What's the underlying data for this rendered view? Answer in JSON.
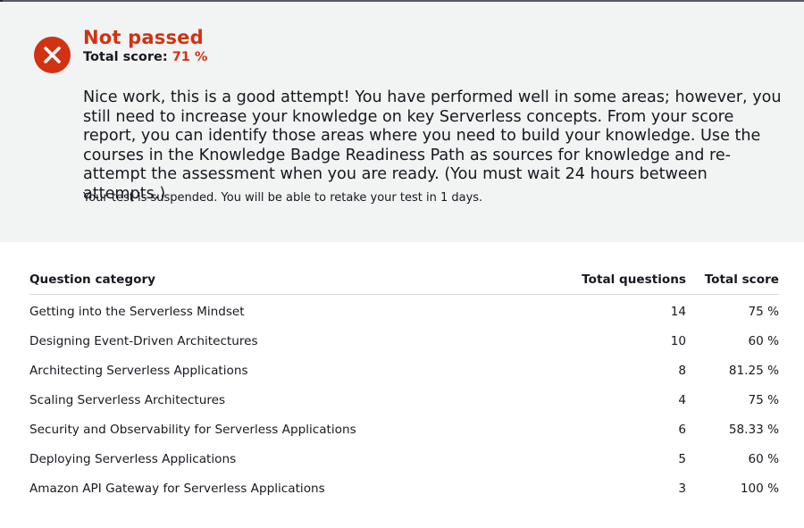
{
  "result": {
    "status": "Not passed",
    "score_label": "Total score:",
    "score_value": "71 %",
    "feedback": "Nice work, this is a good attempt! You have performed well in some areas; however, you still need to increase your knowledge on key Serverless concepts. From your score report, you can identify those areas where you need to build your knowledge. Use the courses in the Knowledge Badge Readiness Path as sources for knowledge and re-attempt the assessment when you are ready. (You must wait 24 hours between attempts.)",
    "suspension_note": "Your test is suspended. You will be able to retake your test in 1 days.",
    "icon": "close-icon"
  },
  "table": {
    "headers": {
      "category": "Question category",
      "questions": "Total questions",
      "score": "Total score"
    },
    "rows": [
      {
        "category": "Getting into the Serverless Mindset",
        "questions": "14",
        "score": "75 %"
      },
      {
        "category": "Designing Event-Driven Architectures",
        "questions": "10",
        "score": "60 %"
      },
      {
        "category": "Architecting Serverless Applications",
        "questions": "8",
        "score": "81.25 %"
      },
      {
        "category": "Scaling Serverless Architectures",
        "questions": "4",
        "score": "75 %"
      },
      {
        "category": "Security and Observability for Serverless Applications",
        "questions": "6",
        "score": "58.33 %"
      },
      {
        "category": "Deploying Serverless Applications",
        "questions": "5",
        "score": "60 %"
      },
      {
        "category": "Amazon API Gateway for Serverless Applications",
        "questions": "3",
        "score": "100 %"
      }
    ]
  },
  "colors": {
    "fail_red": "#d13212",
    "panel_bg": "#f2f3f3",
    "text": "#16191f"
  }
}
